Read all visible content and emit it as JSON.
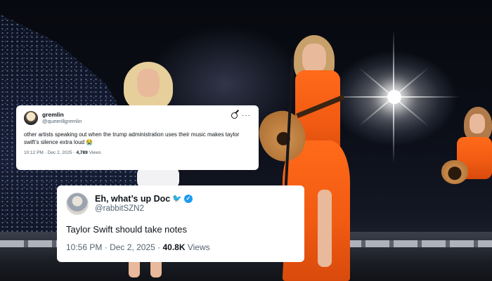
{
  "scene": {
    "description_icons": [
      "concert-stage",
      "spotlight",
      "crowd"
    ]
  },
  "tweet_small": {
    "display_name": "gremlin",
    "handle": "@queerillgremlin",
    "text": "other artists speaking out when the trump administration uses their music makes taylor swift’s silence extra loud 😭",
    "time": "10:12 PM",
    "sep": "·",
    "date": "Dec 2, 2025",
    "views_count": "4,789",
    "views_label": "Views",
    "icons": {
      "grok": "grok-icon",
      "more": "more-options-icon"
    },
    "more_glyph": "···"
  },
  "tweet_big": {
    "display_name": "Eh, what’s up Doc",
    "name_glyph": "🐦",
    "verified_glyph": "✓",
    "handle": "@rabbitSZN2",
    "text": "Taylor Swift should take notes",
    "time": "10:56 PM",
    "sep": "·",
    "date": "Dec 2, 2025",
    "views_count": "40.8K",
    "views_label": "Views"
  },
  "colors": {
    "card_bg": "#ffffff",
    "text_primary": "#0f1419",
    "text_secondary": "#536471",
    "verified_blue": "#1d9bf0",
    "dress_orange": "#f05a12"
  }
}
